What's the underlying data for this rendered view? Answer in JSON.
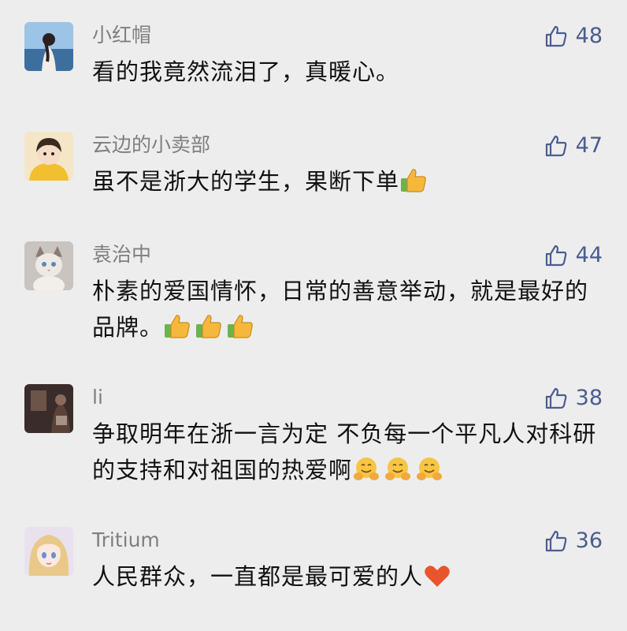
{
  "comments": [
    {
      "name": "小红帽",
      "text": "看的我竟然流泪了，真暖心。",
      "likes": "48",
      "avatar_icon": "girl-at-sea-avatar",
      "emojis": []
    },
    {
      "name": "云边的小卖部",
      "text": "虽不是浙大的学生，果断下单",
      "likes": "47",
      "avatar_icon": "child-in-yellow-avatar",
      "emojis": [
        "thumbs-up"
      ]
    },
    {
      "name": "袁治中",
      "text": "朴素的爱国情怀，日常的善意举动，就是最好的品牌。",
      "likes": "44",
      "avatar_icon": "cat-avatar",
      "emojis": [
        "thumbs-up",
        "thumbs-up",
        "thumbs-up"
      ]
    },
    {
      "name": "li",
      "text": "争取明年在浙一言为定 不负每一个平凡人对科研的支持和对祖国的热爱啊",
      "likes": "38",
      "avatar_icon": "dark-room-avatar",
      "emojis": [
        "hugging-face",
        "hugging-face",
        "hugging-face"
      ]
    },
    {
      "name": "Tritium",
      "text": "人民群众，一直都是最可爱的人",
      "likes": "36",
      "avatar_icon": "anime-girl-avatar",
      "emojis": [
        "red-heart"
      ]
    }
  ],
  "colors": {
    "background": "#ededed",
    "name": "#7f7f7f",
    "like": "#4b5d8f",
    "text": "#111111"
  },
  "like_icon": "thumbs-up-outline-icon"
}
